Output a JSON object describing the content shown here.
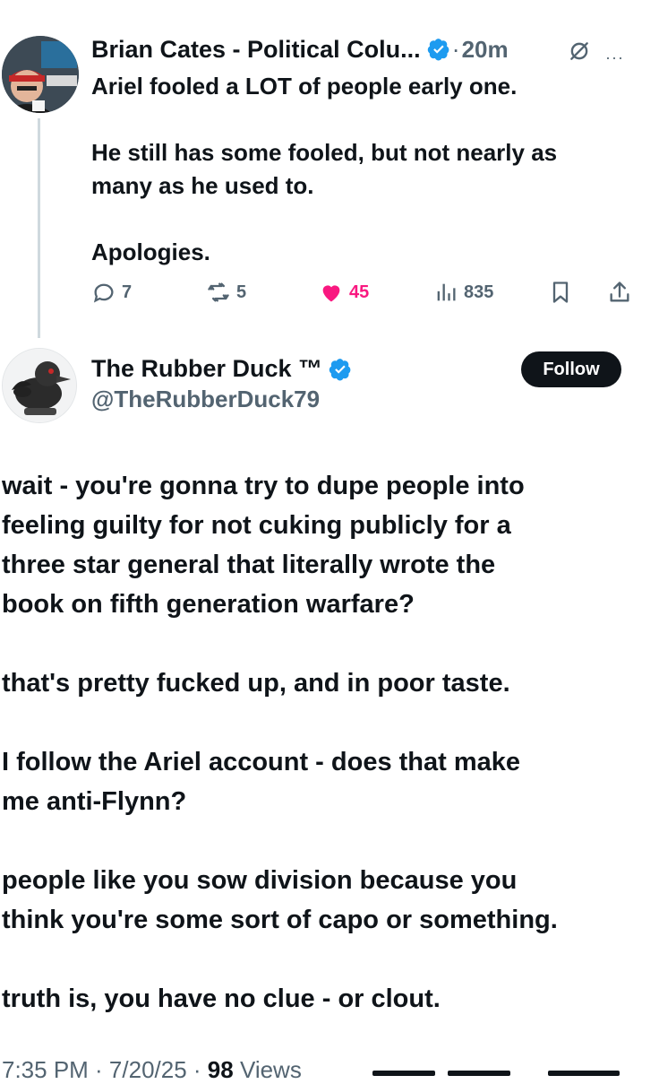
{
  "parent_tweet": {
    "author_name": "Brian Cates - Political Colu...",
    "separator": "·",
    "time": "20m",
    "more_label": "···",
    "lines": [
      "Ariel fooled a LOT of people early one.",
      "",
      "He still has some fooled, but not nearly as",
      "many as he used to.",
      "",
      "Apologies."
    ],
    "stats": {
      "replies": "7",
      "reposts": "5",
      "likes": "45",
      "views": "835"
    }
  },
  "main_tweet": {
    "author_name": "The Rubber Duck ™",
    "handle": "@TheRubberDuck79",
    "follow_label": "Follow",
    "paragraphs": [
      [
        "wait - you're gonna try to dupe people into",
        "feeling guilty for not cuking publicly for a",
        "three star general that literally wrote the",
        "book on fifth generation warfare?"
      ],
      [
        "that's pretty fucked up, and in poor taste."
      ],
      [
        "I follow the Ariel account - does that make",
        "me anti-Flynn?"
      ],
      [
        "people like you sow division because you",
        "think you're some sort of capo or something."
      ],
      [
        "truth is, you have no clue - or clout."
      ]
    ],
    "timestamp": "7:35 PM · 7/20/25 · ",
    "views_count": "98",
    "views_label": " Views"
  },
  "colors": {
    "text": "#0f1419",
    "secondary": "#536471",
    "verified": "#1d9bf0",
    "like": "#f91880",
    "follow_bg": "#0f1419"
  }
}
